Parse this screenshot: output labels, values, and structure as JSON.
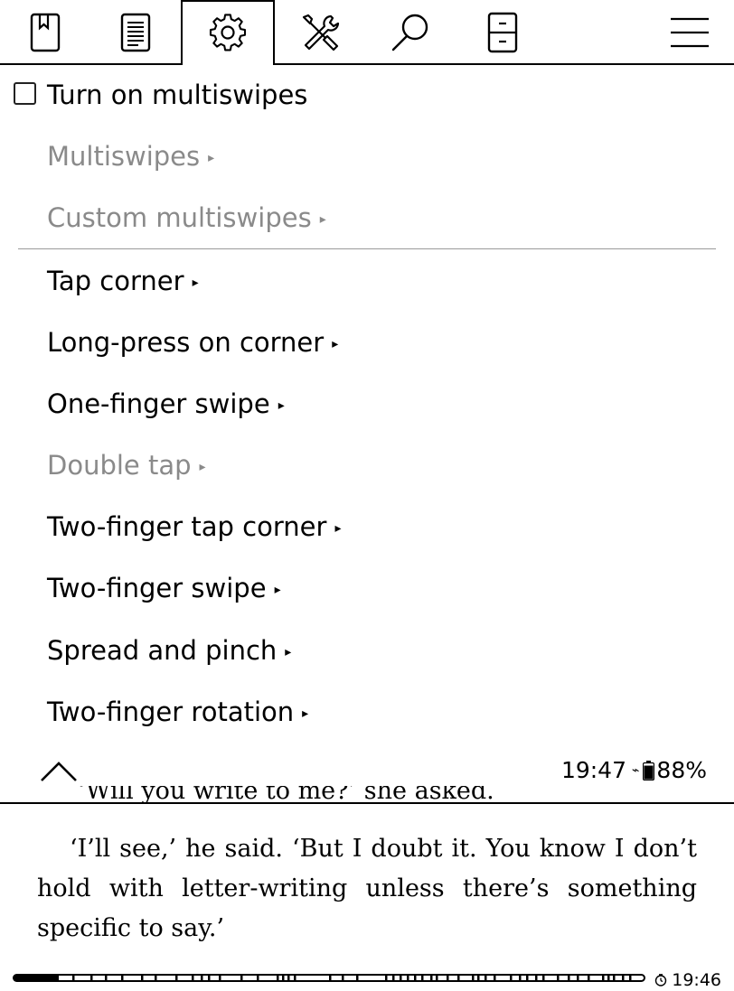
{
  "tabs": [
    {
      "name": "bookmark",
      "icon": "bookmark-icon"
    },
    {
      "name": "contents",
      "icon": "contents-list-icon"
    },
    {
      "name": "settings",
      "icon": "gear-icon",
      "active": true
    },
    {
      "name": "tools",
      "icon": "tools-icon"
    },
    {
      "name": "search",
      "icon": "search-icon"
    },
    {
      "name": "filing-cabinet",
      "icon": "filing-cabinet-icon"
    },
    {
      "name": "menu",
      "icon": "hamburger-menu-icon"
    }
  ],
  "menu": {
    "checkbox_label": "Turn on multiswipes",
    "checkbox_checked": false,
    "items": [
      {
        "label": "Multiswipes",
        "arrow": "▸",
        "enabled": false
      },
      {
        "label": "Custom multiswipes",
        "arrow": "▸",
        "enabled": false
      },
      {
        "label": "Tap corner",
        "arrow": "▸",
        "enabled": true
      },
      {
        "label": "Long-press on corner",
        "arrow": "▸",
        "enabled": true
      },
      {
        "label": "One-finger swipe",
        "arrow": "▸",
        "enabled": true
      },
      {
        "label": "Double tap",
        "arrow": "▸",
        "enabled": false
      },
      {
        "label": "Two-finger tap corner",
        "arrow": "▸",
        "enabled": true
      },
      {
        "label": "Two-finger swipe",
        "arrow": "▸",
        "enabled": true
      },
      {
        "label": "Spread and pinch",
        "arrow": "▸",
        "enabled": true
      },
      {
        "label": "Two-finger rotation",
        "arrow": "▸",
        "enabled": true
      }
    ]
  },
  "status": {
    "time": "19:47",
    "charging_glyph": "⌁",
    "battery": "88%",
    "battery_level": 0.88
  },
  "book": {
    "partial_line": "‘Will you write to me?’ she asked.",
    "paragraph": "‘I’ll see,’ he said. ‘But I doubt it. You know I don’t hold with letter-writing unless there’s something specific to say.’"
  },
  "footer": {
    "progress_fraction": 0.07,
    "clock_time": "19:46"
  },
  "colors": {
    "text": "#000000",
    "disabled_text": "#8a8a8a",
    "divider": "#9a9a9a",
    "background": "#ffffff"
  }
}
